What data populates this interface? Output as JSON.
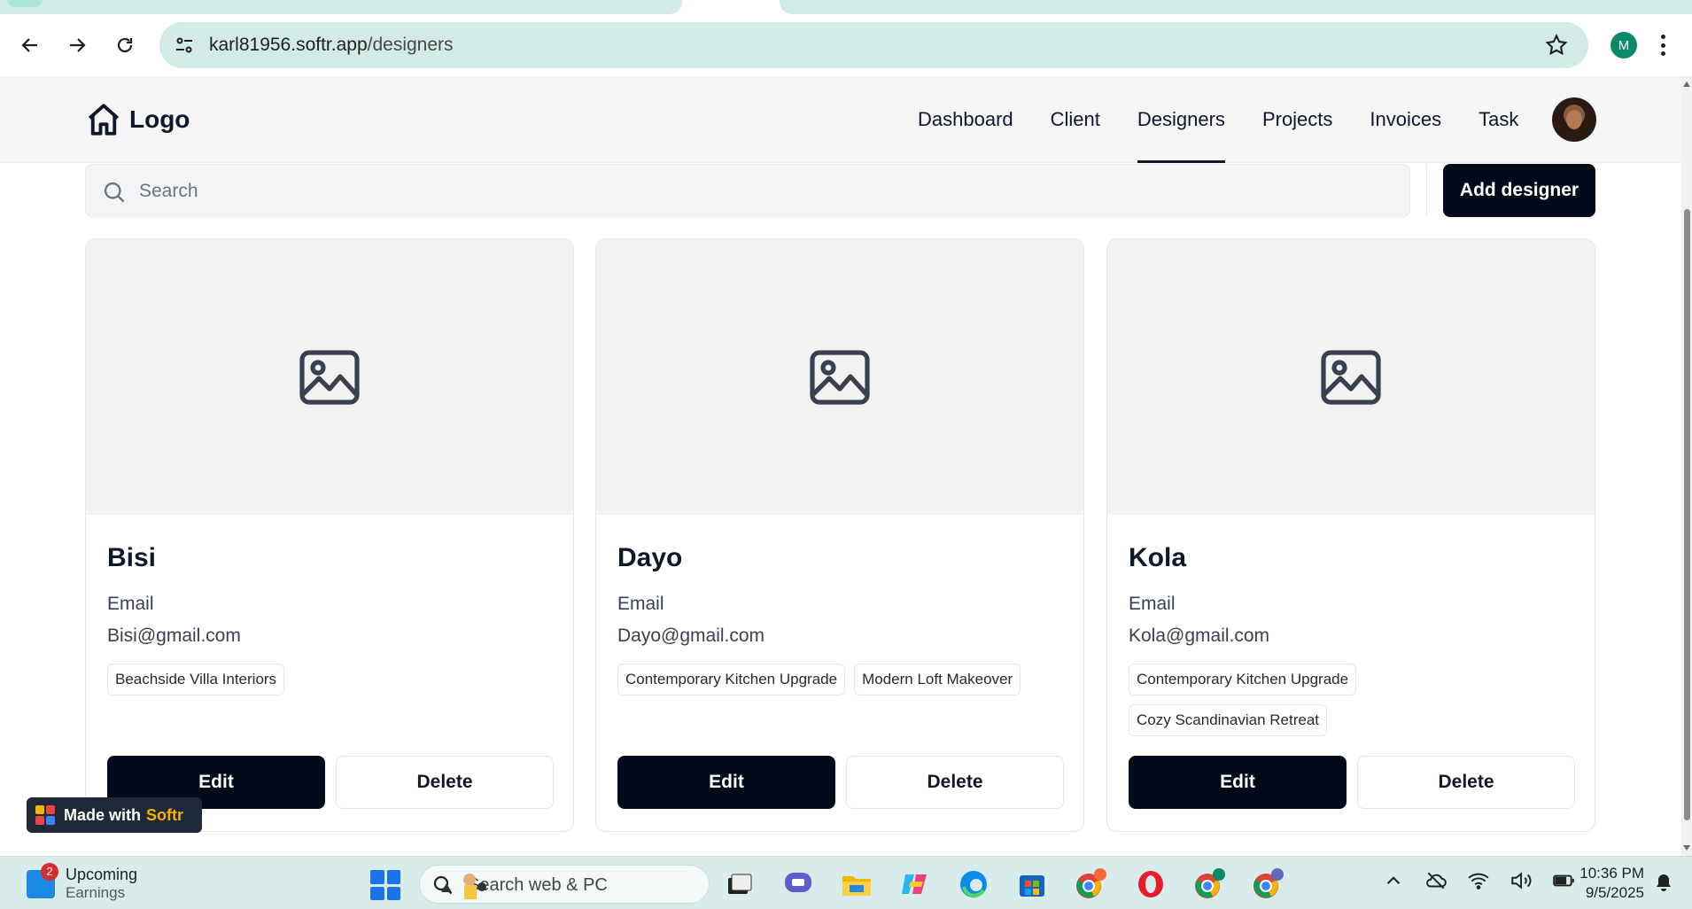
{
  "browser": {
    "url_host": "karl81956.softr.app",
    "url_path": "/designers",
    "profile_initial": "M"
  },
  "app": {
    "logo_text": "Logo",
    "nav": [
      {
        "label": "Dashboard"
      },
      {
        "label": "Client"
      },
      {
        "label": "Designers",
        "active": true
      },
      {
        "label": "Projects"
      },
      {
        "label": "Invoices"
      },
      {
        "label": "Task"
      }
    ],
    "search_placeholder": "Search",
    "add_button_label": "Add designer",
    "cards": [
      {
        "name": "Bisi",
        "email_label": "Email",
        "email": "Bisi@gmail.com",
        "tags": [
          "Beachside Villa Interiors"
        ],
        "edit_label": "Edit",
        "delete_label": "Delete"
      },
      {
        "name": "Dayo",
        "email_label": "Email",
        "email": "Dayo@gmail.com",
        "tags": [
          "Contemporary Kitchen Upgrade",
          "Modern Loft Makeover"
        ],
        "edit_label": "Edit",
        "delete_label": "Delete"
      },
      {
        "name": "Kola",
        "email_label": "Email",
        "email": "Kola@gmail.com",
        "tags": [
          "Contemporary Kitchen Upgrade",
          "Cozy Scandinavian Retreat"
        ],
        "edit_label": "Edit",
        "delete_label": "Delete"
      }
    ],
    "made_with": {
      "prefix": "Made with",
      "brand": "Softr"
    }
  },
  "taskbar": {
    "widget_badge": "2",
    "widget_title": "Upcoming",
    "widget_subtitle": "Earnings",
    "search_text": "Search web & PC",
    "time": "10:36 PM",
    "date": "9/5/2025"
  },
  "colors": {
    "primary_dark": "#030b1a",
    "omnibox": "#d3ebe6",
    "appbar": "#f5f5f5",
    "card_media": "#f2f2f2",
    "softr_brand": "#f5b301"
  }
}
